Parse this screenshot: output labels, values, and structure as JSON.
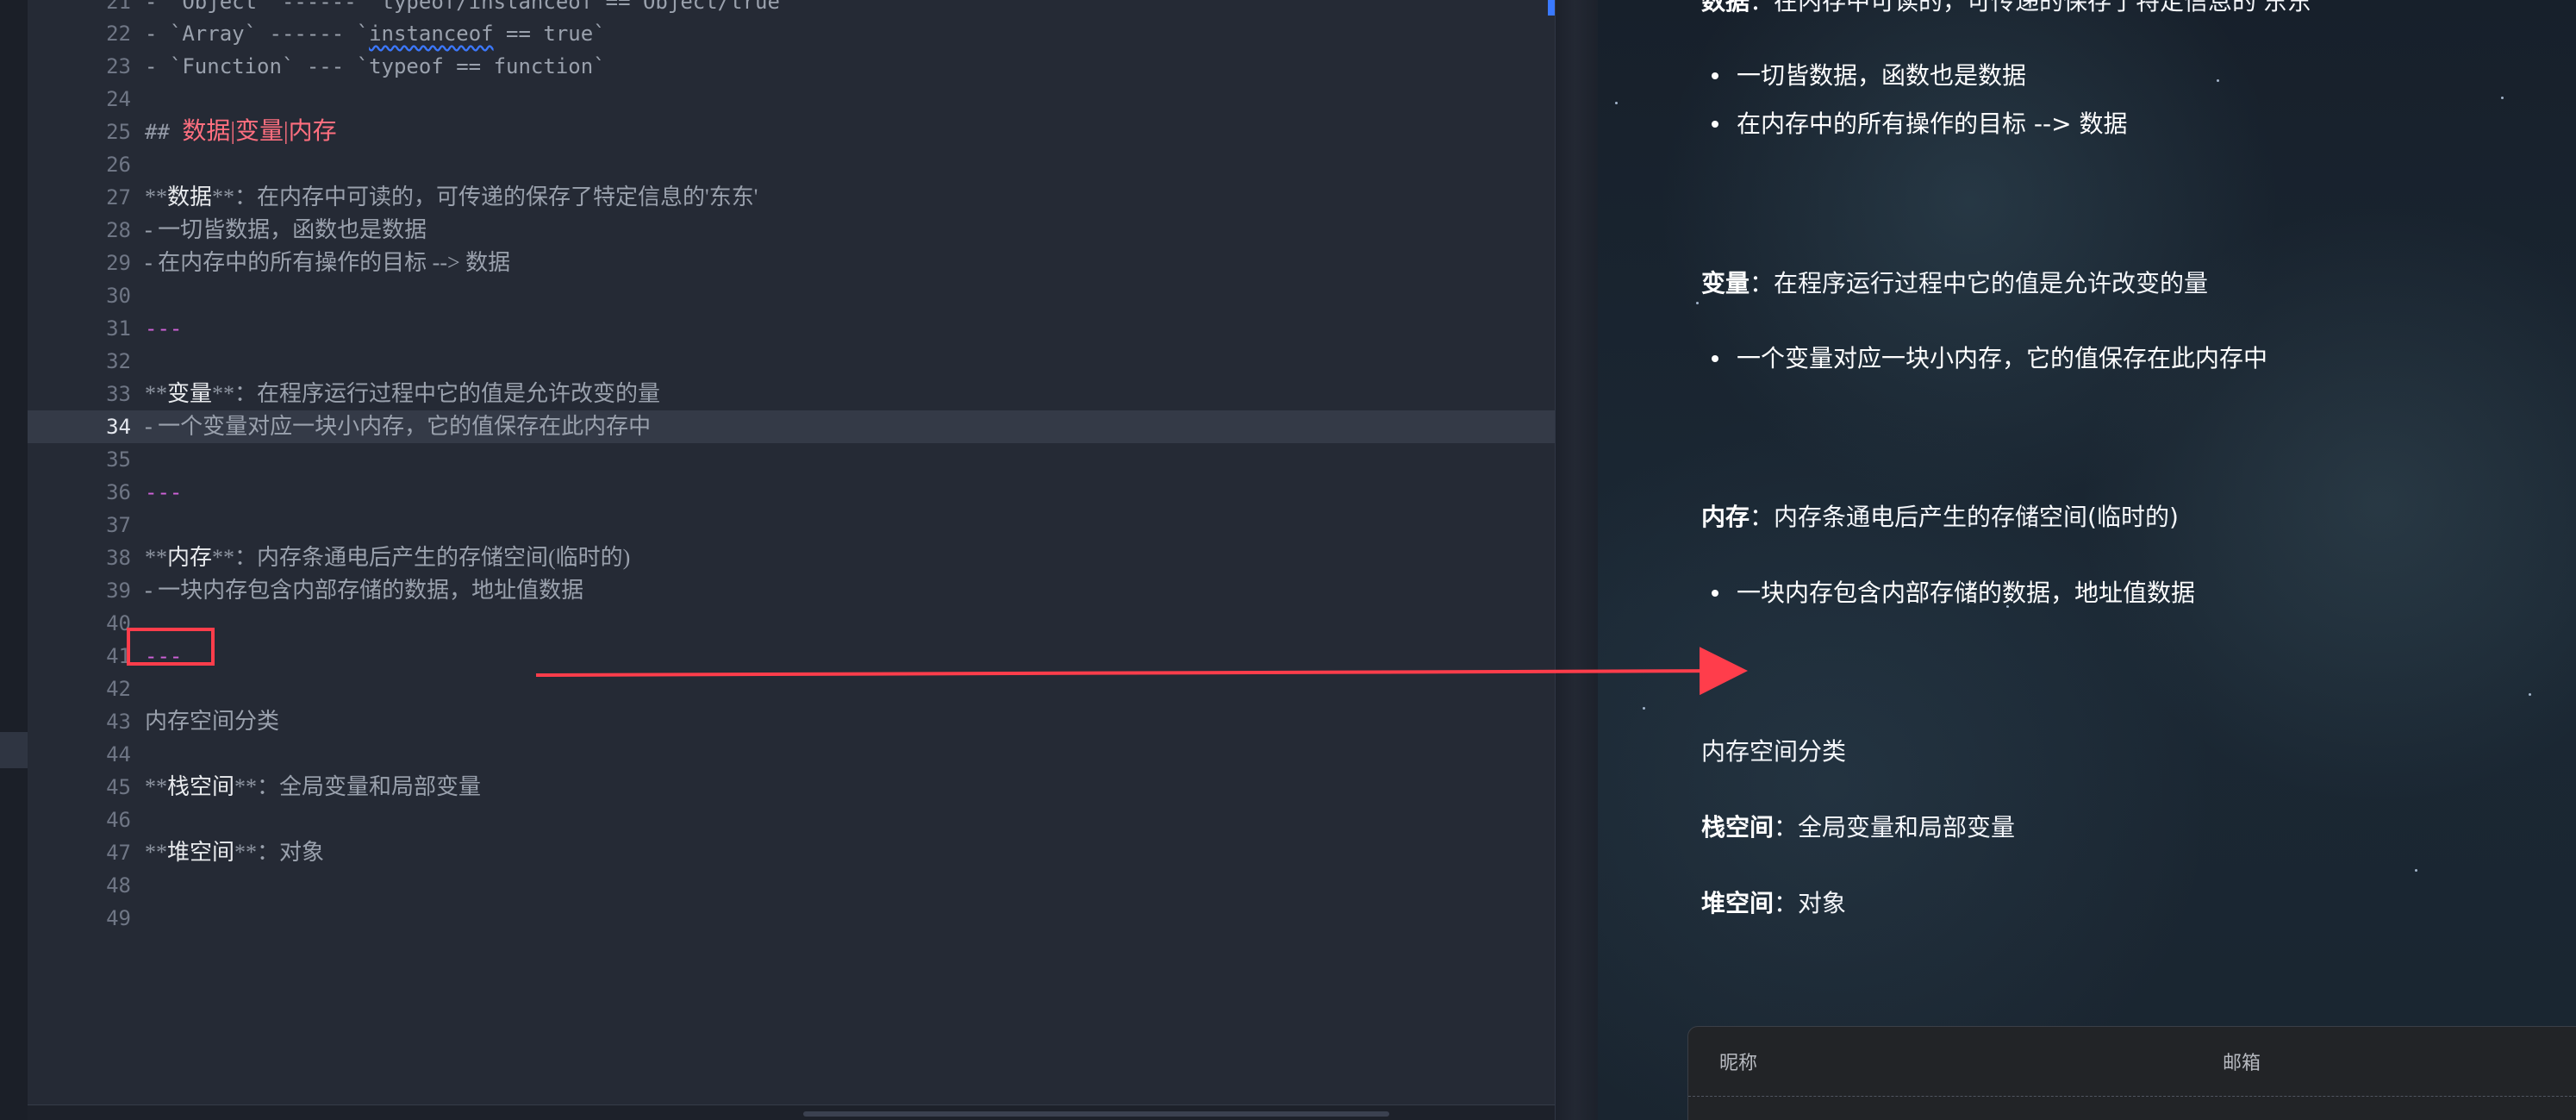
{
  "editor": {
    "lines": [
      {
        "number": "21",
        "text": "- `Object` ------ `typeof/instanceof == Object/true"
      },
      {
        "number": "22",
        "text": "- `Array` ------ `",
        "squiggle": "instanceof",
        "suffix": " == true`"
      },
      {
        "number": "23",
        "text": "- `Function` --- `typeof == function`"
      },
      {
        "number": "24",
        "text": ""
      },
      {
        "number": "25",
        "heading_prefix": "## ",
        "heading": "数据|变量|内存"
      },
      {
        "number": "26",
        "text": ""
      },
      {
        "number": "27",
        "strong_prefix": "**",
        "strong": "数据",
        "strong_suffix": "**",
        "text": "：在内存中可读的，可传递的保存了特定信息的'东东'"
      },
      {
        "number": "28",
        "text": "- 一切皆数据，函数也是数据"
      },
      {
        "number": "29",
        "text": "- 在内存中的所有操作的目标 --> 数据"
      },
      {
        "number": "30",
        "text": ""
      },
      {
        "number": "31",
        "rule": "---"
      },
      {
        "number": "32",
        "text": ""
      },
      {
        "number": "33",
        "strong_prefix": "**",
        "strong": "变量",
        "strong_suffix": "**",
        "text": "：在程序运行过程中它的值是允许改变的量"
      },
      {
        "number": "34",
        "text": "- 一个变量对应一块小内存，它的值保存在此内存中",
        "active": true
      },
      {
        "number": "35",
        "text": ""
      },
      {
        "number": "36",
        "rule": "---"
      },
      {
        "number": "37",
        "text": ""
      },
      {
        "number": "38",
        "strong_prefix": "**",
        "strong": "内存",
        "strong_suffix": "**",
        "text": "：内存条通电后产生的存储空间(临时的)"
      },
      {
        "number": "39",
        "text": "- 一块内存包含内部存储的数据，地址值数据"
      },
      {
        "number": "40",
        "text": ""
      },
      {
        "number": "41",
        "rule": "---"
      },
      {
        "number": "42",
        "text": ""
      },
      {
        "number": "43",
        "text": "内存空间分类"
      },
      {
        "number": "44",
        "text": ""
      },
      {
        "number": "45",
        "strong_prefix": "**",
        "strong": "栈空间",
        "strong_suffix": "**",
        "text": "：全局变量和局部变量"
      },
      {
        "number": "46",
        "text": ""
      },
      {
        "number": "47",
        "strong_prefix": "**",
        "strong": "堆空间",
        "strong_suffix": "**",
        "text": "：对象"
      },
      {
        "number": "48",
        "text": ""
      },
      {
        "number": "49",
        "text": ""
      }
    ]
  },
  "preview": {
    "data_line": {
      "strong": "数据",
      "text": "：在内存中可读的，可传递的保存了特定信息的'东东'"
    },
    "data_bullets": [
      "一切皆数据，函数也是数据",
      "在内存中的所有操作的目标 --> 数据"
    ],
    "variable_line": {
      "strong": "变量",
      "text": "：在程序运行过程中它的值是允许改变的量"
    },
    "variable_bullets": [
      "一个变量对应一块小内存，它的值保存在此内存中"
    ],
    "memory_line": {
      "strong": "内存",
      "text": "：内存条通电后产生的存储空间(临时的)"
    },
    "memory_bullets": [
      "一块内存包含内部存储的数据，地址值数据"
    ],
    "classification": "内存空间分类",
    "stack_line": {
      "strong": "栈空间",
      "text": "：全局变量和局部变量"
    },
    "heap_line": {
      "strong": "堆空间",
      "text": "：对象"
    },
    "table": {
      "nickname_header": "昵称",
      "email_header": "邮箱"
    }
  },
  "annotation": {
    "box_color": "#ff3d4b",
    "arrow_color": "#ff3d4b"
  }
}
